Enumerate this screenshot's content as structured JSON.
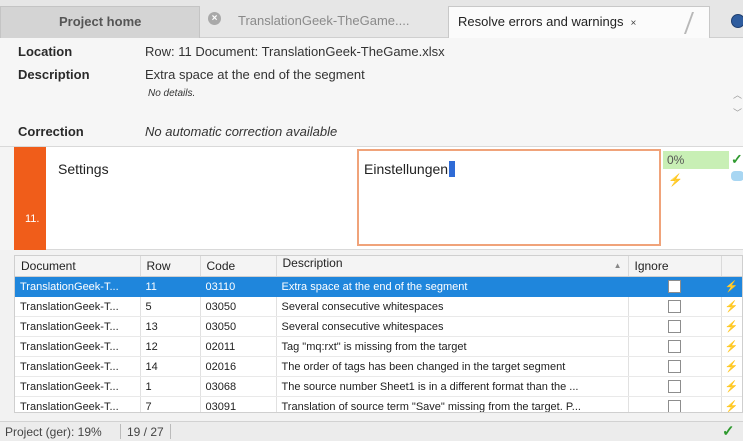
{
  "tabs": {
    "home": "Project home",
    "file": "TranslationGeek-TheGame....",
    "file_close_icon": "close-circle-icon",
    "resolve": "Resolve errors and warnings",
    "resolve_close": "×"
  },
  "details": {
    "location_label": "Location",
    "location_value": "Row: 11  Document: TranslationGeek-TheGame.xlsx",
    "description_label": "Description",
    "description_value": "Extra space at the end of the segment",
    "no_details": "No details.",
    "correction_label": "Correction",
    "correction_value": "No automatic correction available"
  },
  "segment": {
    "number": "11.",
    "source": "Settings",
    "target": "Einstellungen",
    "match": "0%",
    "status_color": "#f05d1a",
    "match_color": "#c8efb5"
  },
  "table": {
    "columns": [
      "Document",
      "Row",
      "Code",
      "Description",
      "Ignore"
    ],
    "rows": [
      {
        "document": "TranslationGeek-T...",
        "row": "11",
        "code": "03110",
        "description": "Extra space at the end of the segment",
        "ignore": false,
        "selected": true
      },
      {
        "document": "TranslationGeek-T...",
        "row": "5",
        "code": "03050",
        "description": "Several consecutive whitespaces",
        "ignore": false,
        "selected": false
      },
      {
        "document": "TranslationGeek-T...",
        "row": "13",
        "code": "03050",
        "description": "Several consecutive whitespaces",
        "ignore": false,
        "selected": false
      },
      {
        "document": "TranslationGeek-T...",
        "row": "12",
        "code": "02011",
        "description": "Tag \"mq:rxt\" is missing from the target",
        "ignore": false,
        "selected": false
      },
      {
        "document": "TranslationGeek-T...",
        "row": "14",
        "code": "02016",
        "description": "The order of tags has been changed in the target segment",
        "ignore": false,
        "selected": false
      },
      {
        "document": "TranslationGeek-T...",
        "row": "1",
        "code": "03068",
        "description": "The source number Sheet1 is in a different format than the ...",
        "ignore": false,
        "selected": false
      },
      {
        "document": "TranslationGeek-T...",
        "row": "7",
        "code": "03091",
        "description": "Translation of source term \"Save\" missing from the target. P...",
        "ignore": false,
        "selected": false
      }
    ],
    "selection_color": "#1f86dc"
  },
  "status": {
    "progress": "Project (ger): 19%",
    "count": "19 / 27"
  },
  "icons": {
    "help": "help-icon",
    "warning_flag": "lightning-flag-icon",
    "ok": "checkmark-icon",
    "comment": "comment-icon"
  }
}
